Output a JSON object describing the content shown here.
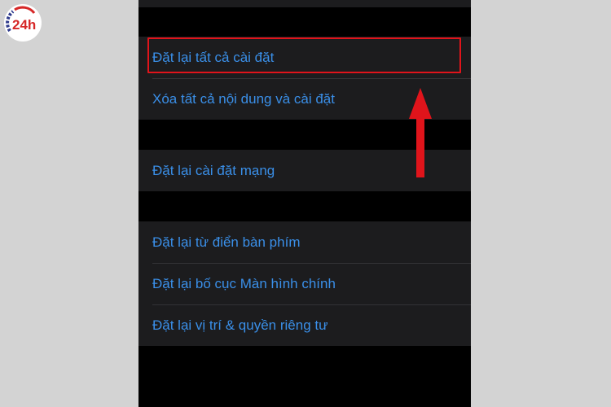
{
  "brand": {
    "logo_text": "24h",
    "logo_superscript": "h"
  },
  "reset_menu": {
    "group1": [
      {
        "label": "Đặt lại tất cả cài đặt"
      },
      {
        "label": "Xóa tất cả nội dung và cài đặt"
      }
    ],
    "group2": [
      {
        "label": "Đặt lại cài đặt mạng"
      }
    ],
    "group3": [
      {
        "label": "Đặt lại từ điển bàn phím"
      },
      {
        "label": "Đặt lại bố cục Màn hình chính"
      },
      {
        "label": "Đặt lại vị trí & quyền riêng tư"
      }
    ]
  },
  "colors": {
    "background": "#d3d3d3",
    "screen": "#000000",
    "cell": "#1c1c1e",
    "link_blue": "#3a8fe8",
    "highlight_red": "#e0141b"
  },
  "icons": {
    "logo": "24h-logo-icon",
    "annotation": "red-up-arrow-icon"
  }
}
